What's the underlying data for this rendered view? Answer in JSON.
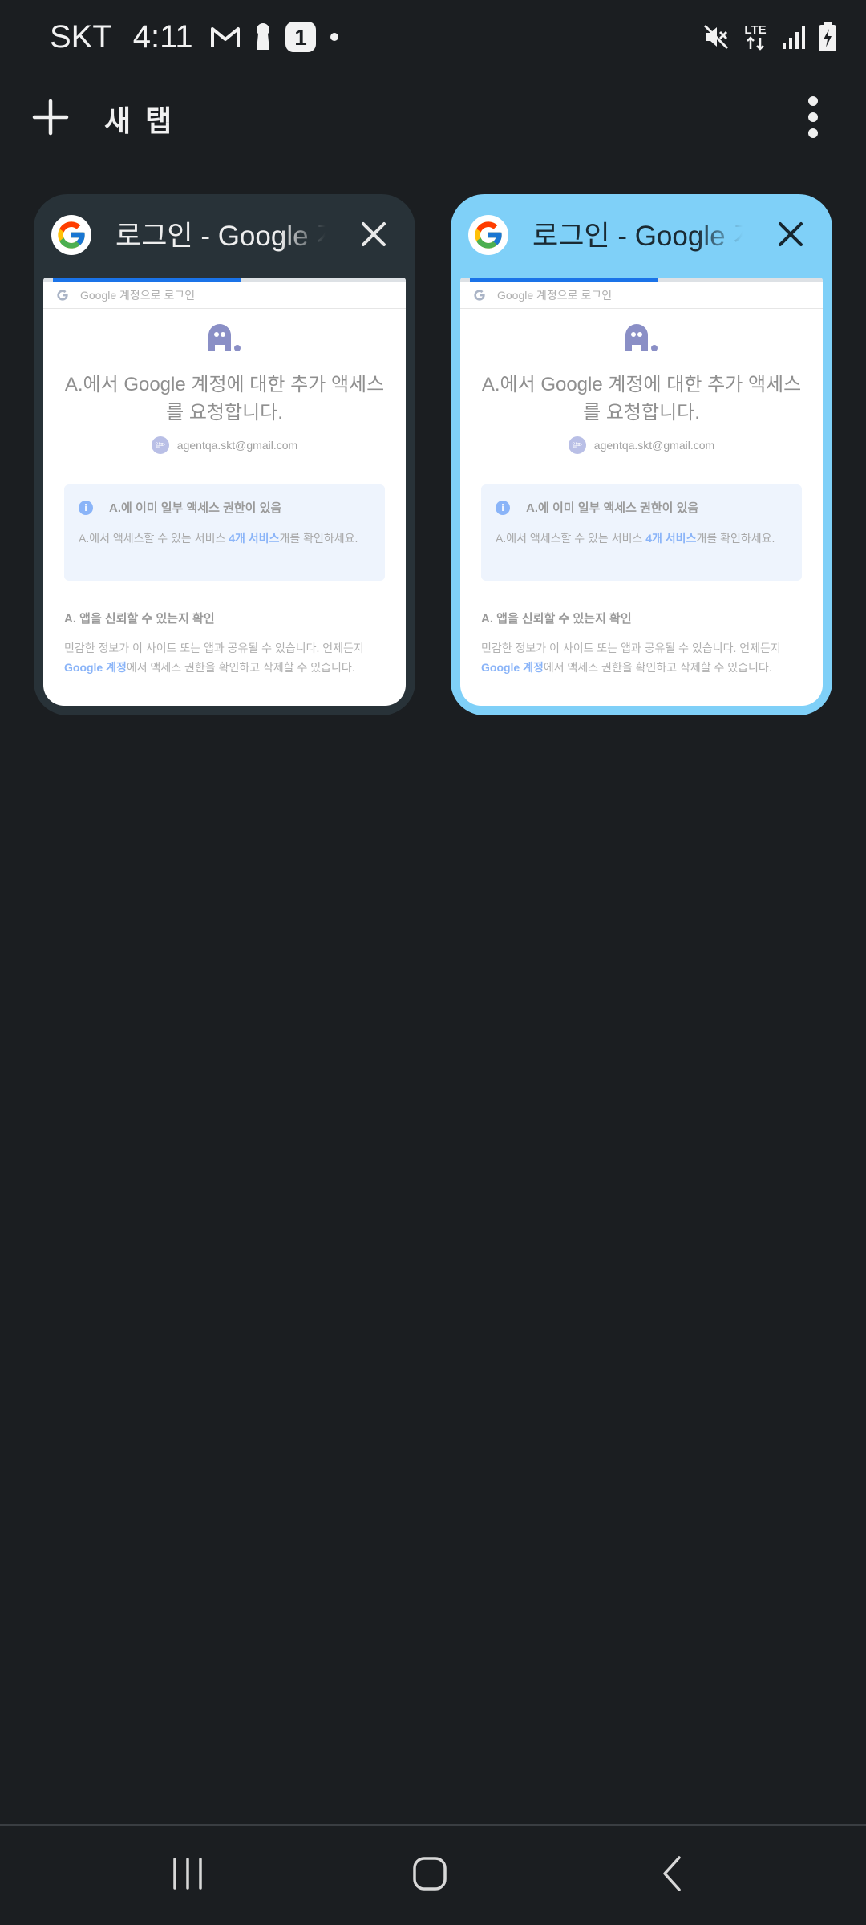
{
  "status_bar": {
    "carrier": "SKT",
    "time": "4:11",
    "notification_count": "1",
    "icons_left": [
      "gmail-icon",
      "keyhole-icon",
      "notification-count-badge",
      "dot-icon"
    ],
    "icons_right": [
      "mute-icon",
      "lte-icon",
      "signal-icon",
      "battery-charging-icon"
    ],
    "lte_label": "LTE"
  },
  "toolbar": {
    "new_tab_label": "새 탭",
    "icons": [
      "plus-icon",
      "more-vert-icon"
    ]
  },
  "tabs": [
    {
      "title": "로그인 - Google 계정",
      "selected": false,
      "progress": 0.52,
      "preview": {
        "header": "Google 계정으로 로그인",
        "heading": "A.에서 Google 계정에 대한 추가 액세스를 요청합니다.",
        "avatar_text": "알파",
        "account": "agentqa.skt@gmail.com",
        "info_title": "A.에 이미 일부 액세스 권한이 있음",
        "info_body_before": "A.에서 액세스할 수 있는 서비스 ",
        "info_body_link": "4개 서비스",
        "info_body_after": "개를 확인하세요.",
        "trust_title": "A. 앱을 신뢰할 수 있는지 확인",
        "trust_body_before": "민감한 정보가 이 사이트 또는 앱과 공유될 수 있습니다. 언제든지 ",
        "trust_body_link": "Google 계정",
        "trust_body_after": "에서 액세스 권한을 확인하고 삭제할 수 있습니다."
      }
    },
    {
      "title": "로그인 - Google 계정",
      "selected": true,
      "progress": 0.52,
      "preview": {
        "header": "Google 계정으로 로그인",
        "heading": "A.에서 Google 계정에 대한 추가 액세스를 요청합니다.",
        "avatar_text": "알파",
        "account": "agentqa.skt@gmail.com",
        "info_title": "A.에 이미 일부 액세스 권한이 있음",
        "info_body_before": "A.에서 액세스할 수 있는 서비스 ",
        "info_body_link": "4개 서비스",
        "info_body_after": "개를 확인하세요.",
        "trust_title": "A. 앱을 신뢰할 수 있는지 확인",
        "trust_body_before": "민감한 정보가 이 사이트 또는 앱과 공유될 수 있습니다. 언제든지 ",
        "trust_body_link": "Google 계정",
        "trust_body_after": "에서 액세스 권한을 확인하고 삭제할 수 있습니다."
      }
    }
  ],
  "nav_bar": {
    "buttons": [
      "recents-icon",
      "home-icon",
      "back-icon"
    ]
  },
  "colors": {
    "background": "#1b1e21",
    "card": "#283238",
    "card_selected": "#7fd0f8",
    "progress": "#1a73e8",
    "link": "#8ab4f8"
  }
}
